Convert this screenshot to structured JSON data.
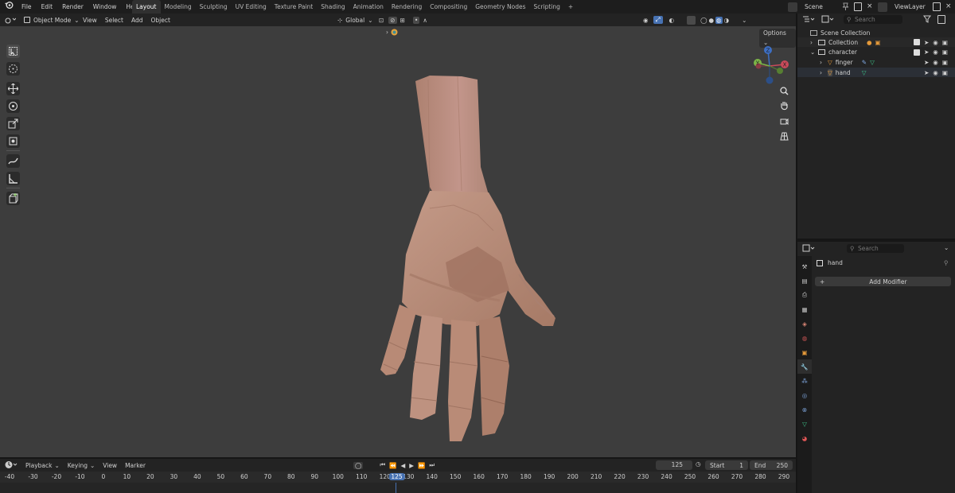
{
  "topbar": {
    "menus": [
      "File",
      "Edit",
      "Render",
      "Window",
      "Help"
    ],
    "tabs": [
      "Layout",
      "Modeling",
      "Sculpting",
      "UV Editing",
      "Texture Paint",
      "Shading",
      "Animation",
      "Rendering",
      "Compositing",
      "Geometry Nodes",
      "Scripting"
    ],
    "active_tab": "Layout",
    "add_tab": "+",
    "scene": "Scene",
    "view_layer": "ViewLayer"
  },
  "viewport_header": {
    "mode": "Object Mode",
    "menus": [
      "View",
      "Select",
      "Add",
      "Object"
    ],
    "orientation": "Global",
    "options": "Options"
  },
  "outliner": {
    "search_placeholder": "Search",
    "root": "Scene Collection",
    "items": [
      {
        "label": "Collection"
      },
      {
        "label": "character"
      },
      {
        "label": "finger"
      },
      {
        "label": "hand"
      }
    ]
  },
  "properties": {
    "search_placeholder": "Search",
    "object_name": "hand",
    "add_modifier": "Add Modifier"
  },
  "timeline": {
    "menus": [
      "Playback",
      "Keying",
      "View",
      "Marker"
    ],
    "current_frame": "125",
    "start_label": "Start",
    "start_value": "1",
    "end_label": "End",
    "end_value": "250",
    "ruler_labels": [
      "-40",
      "-30",
      "-20",
      "-10",
      "0",
      "10",
      "20",
      "30",
      "40",
      "50",
      "60",
      "70",
      "80",
      "90",
      "100",
      "110",
      "120",
      "125",
      "130",
      "140",
      "150",
      "160",
      "170",
      "180",
      "190",
      "200",
      "210",
      "220",
      "230",
      "240",
      "250",
      "260",
      "270",
      "280",
      "290"
    ]
  },
  "colors": {
    "accent": "#4772b3",
    "skin": "#b88a76",
    "viewport_bg": "#3d3d3d",
    "panel_bg": "#232323"
  }
}
